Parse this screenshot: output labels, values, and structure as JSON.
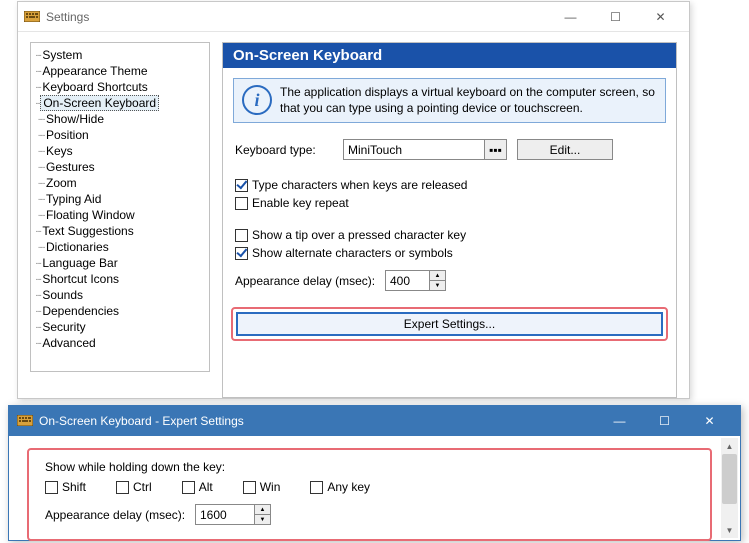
{
  "win1": {
    "title": "Settings",
    "buttons": {
      "min": "—",
      "max": "☐",
      "close": "✕"
    }
  },
  "tree": {
    "items": [
      {
        "label": "System",
        "indent": 1,
        "selected": false
      },
      {
        "label": "Appearance Theme",
        "indent": 1,
        "selected": false
      },
      {
        "label": "Keyboard Shortcuts",
        "indent": 1,
        "selected": false
      },
      {
        "label": "On-Screen Keyboard",
        "indent": 1,
        "selected": true
      },
      {
        "label": "Show/Hide",
        "indent": 2,
        "selected": false
      },
      {
        "label": "Position",
        "indent": 2,
        "selected": false
      },
      {
        "label": "Keys",
        "indent": 2,
        "selected": false
      },
      {
        "label": "Gestures",
        "indent": 2,
        "selected": false
      },
      {
        "label": "Zoom",
        "indent": 2,
        "selected": false
      },
      {
        "label": "Typing Aid",
        "indent": 2,
        "selected": false
      },
      {
        "label": "Floating Window",
        "indent": 2,
        "selected": false
      },
      {
        "label": "Text Suggestions",
        "indent": 1,
        "selected": false
      },
      {
        "label": "Dictionaries",
        "indent": 2,
        "selected": false
      },
      {
        "label": "Language Bar",
        "indent": 1,
        "selected": false
      },
      {
        "label": "Shortcut Icons",
        "indent": 1,
        "selected": false
      },
      {
        "label": "Sounds",
        "indent": 1,
        "selected": false
      },
      {
        "label": "Dependencies",
        "indent": 1,
        "selected": false
      },
      {
        "label": "Security",
        "indent": 1,
        "selected": false
      },
      {
        "label": "Advanced",
        "indent": 1,
        "selected": false
      }
    ]
  },
  "panel": {
    "title": "On-Screen Keyboard",
    "info": "The application displays a virtual keyboard on the computer screen, so that you can type using a pointing device or touchscreen.",
    "type_label": "Keyboard type:",
    "type_value": "MiniTouch",
    "type_browse": "▪▪▪",
    "edit_label": "Edit...",
    "cb1": {
      "label": "Type characters when keys are released",
      "checked": true
    },
    "cb2": {
      "label": "Enable key repeat",
      "checked": false
    },
    "cb3": {
      "label": "Show a tip over a pressed character key",
      "checked": false
    },
    "cb4": {
      "label": "Show alternate characters or symbols",
      "checked": true
    },
    "delay_label": "Appearance delay (msec):",
    "delay_value": "400",
    "expert_label": "Expert Settings..."
  },
  "win2": {
    "title": "On-Screen Keyboard - Expert Settings",
    "buttons": {
      "min": "—",
      "max": "☐",
      "close": "✕"
    }
  },
  "expert": {
    "heading": "Show while holding down the key:",
    "mods": [
      {
        "label": "Shift",
        "checked": false
      },
      {
        "label": "Ctrl",
        "checked": false
      },
      {
        "label": "Alt",
        "checked": false
      },
      {
        "label": "Win",
        "checked": false
      },
      {
        "label": "Any key",
        "checked": false
      }
    ],
    "delay_label": "Appearance delay (msec):",
    "delay_value": "1600"
  }
}
